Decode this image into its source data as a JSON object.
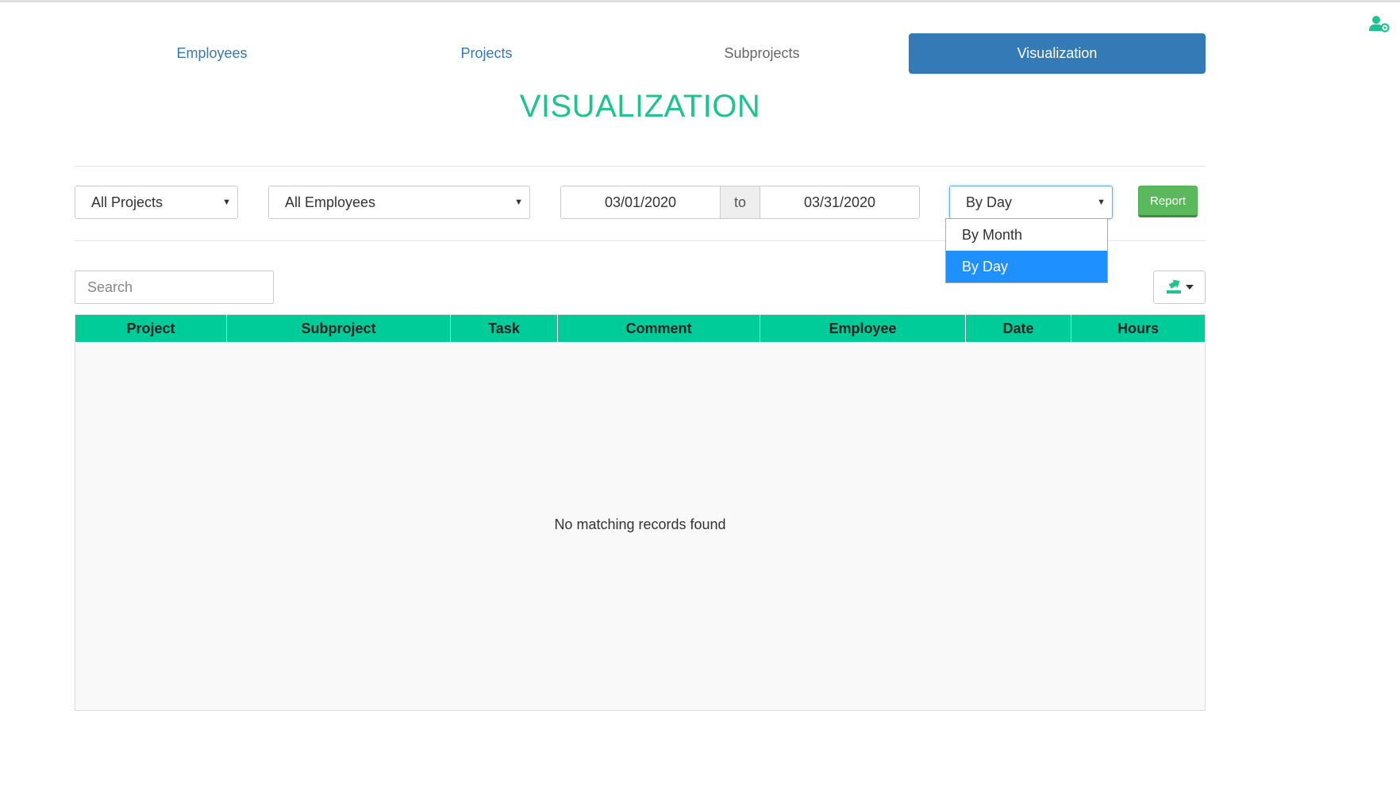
{
  "nav": {
    "tabs": [
      {
        "label": "Employees"
      },
      {
        "label": "Projects"
      },
      {
        "label": "Subprojects"
      },
      {
        "label": "Visualization"
      }
    ]
  },
  "page": {
    "title": "VISUALIZATION"
  },
  "filters": {
    "project": {
      "value": "All Projects"
    },
    "employee": {
      "value": "All Employees"
    },
    "date_from": "03/01/2020",
    "date_separator": "to",
    "date_to": "03/31/2020",
    "granularity": {
      "value": "By Day",
      "options": [
        "By Month",
        "By Day"
      ]
    },
    "report_label": "Report"
  },
  "search": {
    "placeholder": "Search"
  },
  "table": {
    "columns": [
      "Project",
      "Subproject",
      "Task",
      "Comment",
      "Employee",
      "Date",
      "Hours"
    ],
    "empty_message": "No matching records found"
  },
  "colors": {
    "accent": "#1ec48f",
    "header_bg": "#00cc99",
    "active_tab": "#337ab7",
    "report_button": "#5cb85c",
    "dropdown_highlight": "#1e90ff"
  },
  "icons": {
    "top_right": "user-settings-icon",
    "export": "export-icon"
  }
}
